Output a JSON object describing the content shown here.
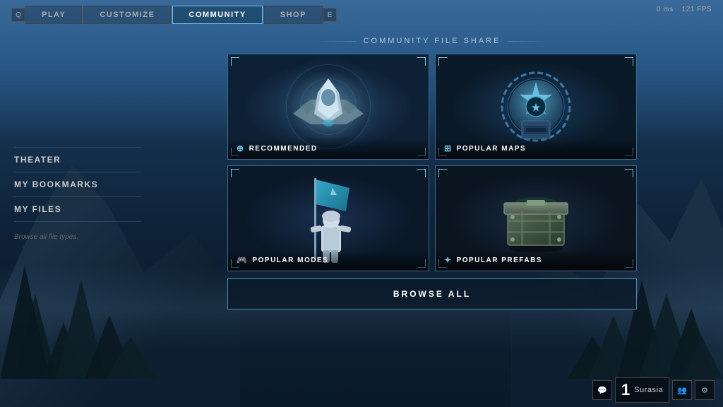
{
  "perf": {
    "ms": "0 ms",
    "fps": "121 FPS"
  },
  "nav": {
    "left_key": "Q",
    "right_key": "E",
    "tabs": [
      {
        "label": "PLAY",
        "active": false
      },
      {
        "label": "CUSTOMIZE",
        "active": false
      },
      {
        "label": "COMMUNITY",
        "active": true
      },
      {
        "label": "SHOP",
        "active": false
      }
    ]
  },
  "section_title": "COMMUNITY FILE SHARE",
  "sidebar": {
    "items": [
      {
        "label": "THEATER"
      },
      {
        "label": "MY BOOKMARKS"
      },
      {
        "label": "MY FILES"
      }
    ],
    "hint": "Browse all file types."
  },
  "cards": [
    {
      "id": "recommended",
      "label": "RECOMMENDED",
      "icon": "⊕"
    },
    {
      "id": "popular-maps",
      "label": "POPULAR MAPS",
      "icon": "⊞"
    },
    {
      "id": "popular-modes",
      "label": "POPULAR MODES",
      "icon": "🎮"
    },
    {
      "id": "popular-prefabs",
      "label": "POPULAR PREFABS",
      "icon": "✦"
    }
  ],
  "browse_all_label": "BROWSE ALL",
  "bottom": {
    "player_number": "1",
    "player_name": "Surasia"
  }
}
